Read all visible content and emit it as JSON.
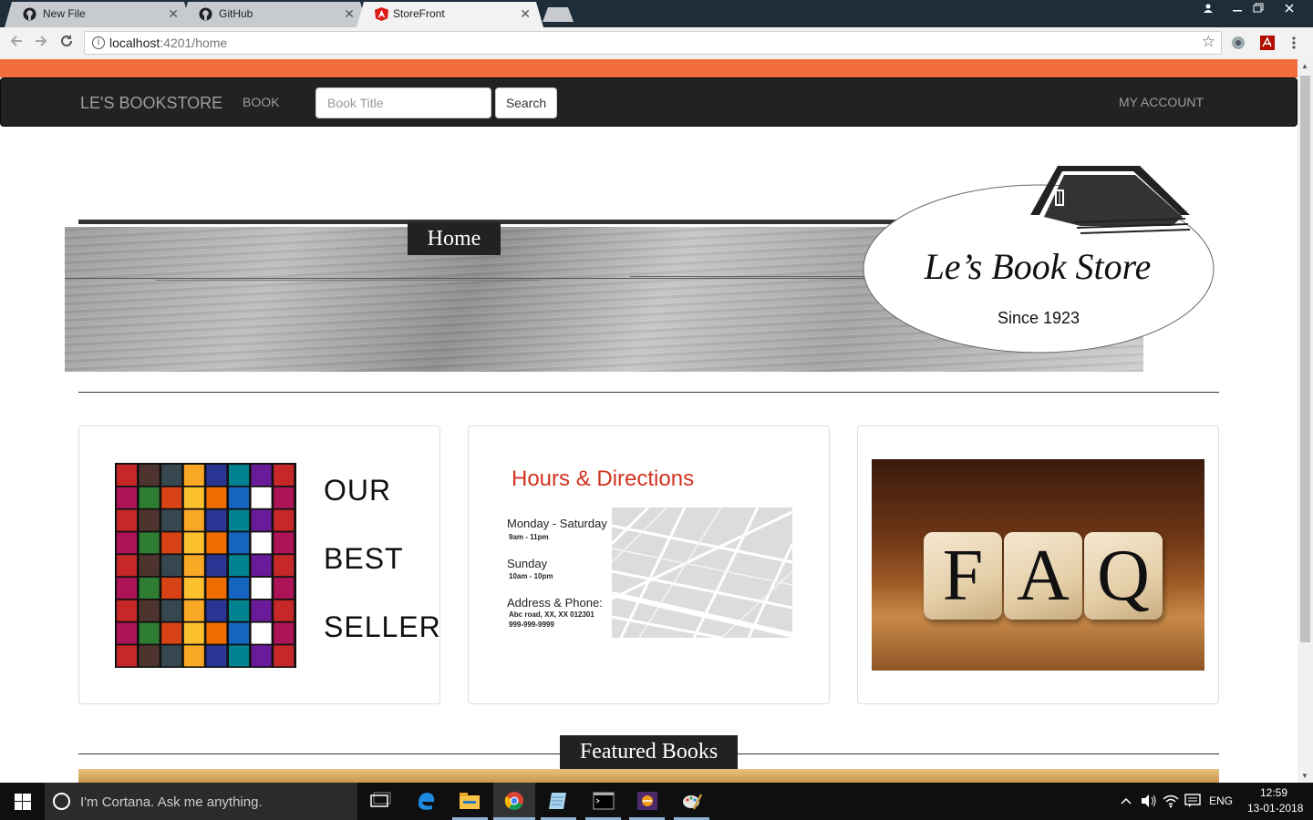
{
  "browser": {
    "tabs": [
      {
        "label": "New File",
        "icon": "github-icon",
        "active": false
      },
      {
        "label": "GitHub",
        "icon": "github-icon",
        "active": false
      },
      {
        "label": "StoreFront",
        "icon": "angular-icon",
        "active": true
      }
    ],
    "url_host": "localhost",
    "url_path": ":4201/home",
    "close_glyph": "✕"
  },
  "navbar": {
    "brand": "LE'S BOOKSTORE",
    "book_link": "BOOK",
    "search_placeholder": "Book Title",
    "search_button": "Search",
    "account_link": "MY ACCOUNT"
  },
  "banner": {
    "home_label": "Home",
    "logo_title": "Le’s Book Store",
    "logo_since": "Since 1923"
  },
  "cards": {
    "bestseller": {
      "lines": [
        "OUR",
        "BEST",
        "SELLER"
      ]
    },
    "hours": {
      "title": "Hours & Directions",
      "weekday_label": "Monday - Saturday",
      "weekday_hours": "9am - 11pm",
      "sunday_label": "Sunday",
      "sunday_hours": "10am - 10pm",
      "address_label": "Address & Phone:",
      "address": "Abc road, XX, XX 012301",
      "phone": "999-999-9999"
    },
    "faq": {
      "letters": [
        "F",
        "A",
        "Q"
      ]
    }
  },
  "featured_label": "Featured Books",
  "taskbar": {
    "cortana_text": "I'm Cortana. Ask me anything.",
    "language": "ENG",
    "time": "12:59",
    "date": "13-01-2018"
  },
  "colors": {
    "accent_orange": "#f36c3d",
    "navbar_bg": "#222222",
    "hours_title": "#d0331f"
  }
}
